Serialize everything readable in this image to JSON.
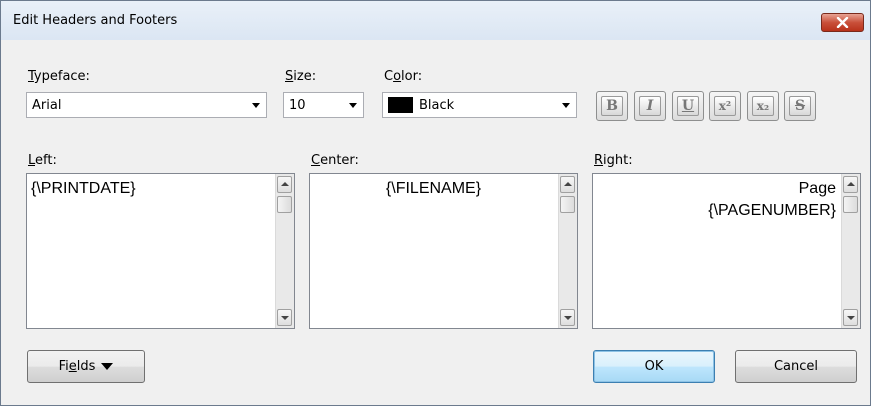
{
  "window": {
    "title": "Edit Headers and Footers"
  },
  "typeface": {
    "label_accel": "T",
    "label_rest": "ypeface:",
    "value": "Arial"
  },
  "size": {
    "label_accel": "S",
    "label_rest": "ize:",
    "value": "10"
  },
  "color": {
    "label_pre": "C",
    "label_accel": "o",
    "label_rest": "lor:",
    "value": "Black",
    "swatch": "#000000"
  },
  "format_buttons": [
    {
      "name": "bold",
      "glyph": "B"
    },
    {
      "name": "italic",
      "glyph": "I"
    },
    {
      "name": "underline",
      "glyph": "U"
    },
    {
      "name": "superscript",
      "glyph": "x²"
    },
    {
      "name": "subscript",
      "glyph": "x₂"
    },
    {
      "name": "strikethrough",
      "glyph": "S"
    }
  ],
  "left": {
    "label_accel": "L",
    "label_rest": "eft:",
    "text": "{\\PRINTDATE}"
  },
  "center": {
    "label_accel": "C",
    "label_rest": "enter:",
    "text": "{\\FILENAME}"
  },
  "right": {
    "label_accel": "R",
    "label_rest": "ight:",
    "line1": "Page",
    "line2": "{\\PAGENUMBER}"
  },
  "buttons": {
    "fields_pre": "Fi",
    "fields_accel": "e",
    "fields_rest": "lds",
    "ok": "OK",
    "cancel": "Cancel"
  }
}
